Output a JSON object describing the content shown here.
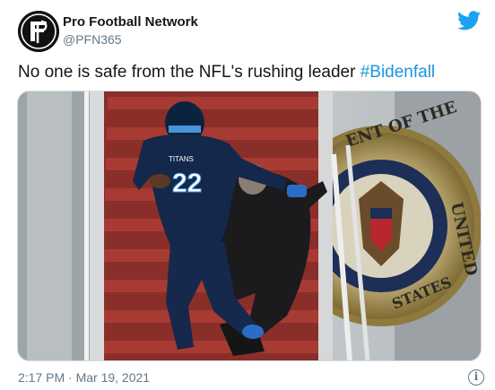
{
  "account": {
    "display_name": "Pro Football Network",
    "handle": "@PFN365",
    "avatar_icon": "pfn-logo-avatar"
  },
  "platform_icon": "twitter-bird-icon",
  "tweet": {
    "text": "No one is safe from the NFL's rushing leader ",
    "hashtag": "#Bidenfall"
  },
  "media": {
    "jersey_number": "22",
    "jersey_brand": "TITANS",
    "seal_text_top": "ENT OF THE",
    "seal_text_right": "UNITED",
    "seal_text_bottom": "STATES"
  },
  "footer": {
    "timestamp": "2:17 PM · Mar 19, 2021",
    "info_icon": "info-icon"
  },
  "colors": {
    "accent": "#1da1f2",
    "hashtag": "#1b95e0",
    "text_primary": "#14171a",
    "text_secondary": "#657786"
  }
}
